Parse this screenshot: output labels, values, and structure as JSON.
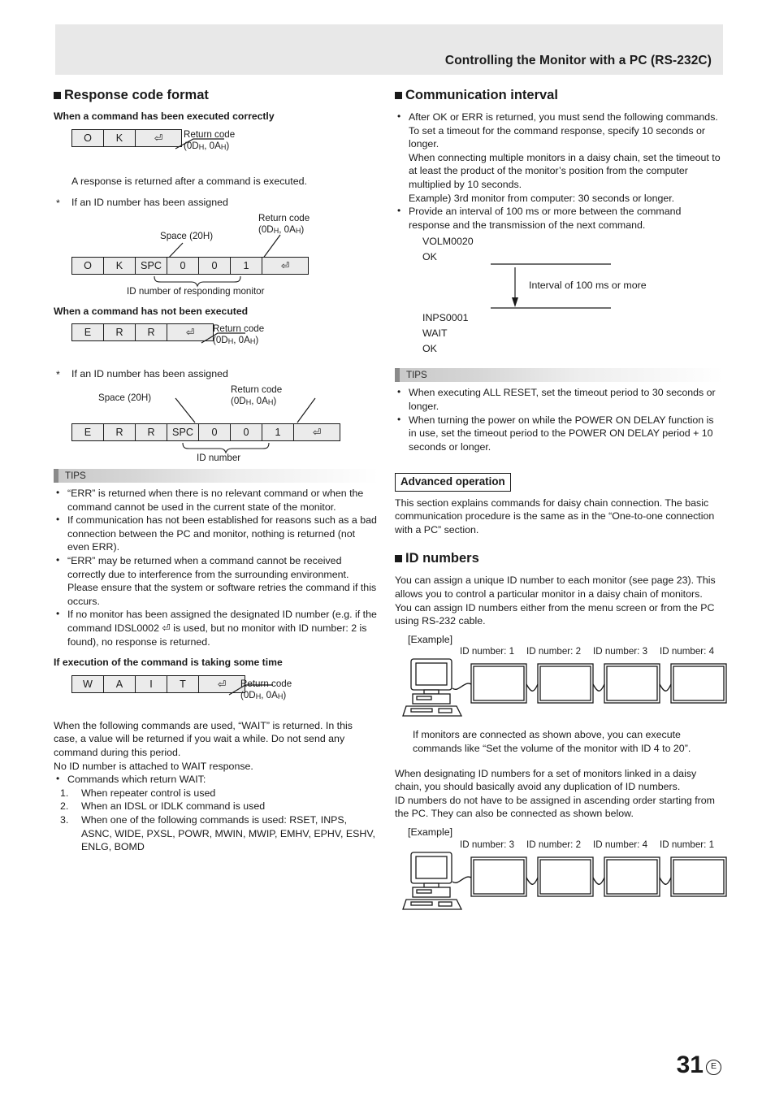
{
  "header": {
    "title": "Controlling the Monitor with a PC (RS-232C)"
  },
  "left": {
    "section_title": "Response code format",
    "sub1": "When a command has been executed correctly",
    "ok_cells": [
      "O",
      "K",
      "⏎"
    ],
    "ok_callout_line1": "Return code",
    "ok_callout_line2": "(0DH, 0AH)",
    "p_response": "A response is returned after a command is executed.",
    "star_id_assigned": "If an ID number has been assigned",
    "space_label": "Space (20H)",
    "ok_id_cells": [
      "O",
      "K",
      "SPC",
      "0",
      "0",
      "1",
      "⏎"
    ],
    "ok_id_brace_label": "ID number of responding monitor",
    "sub2": "When a command has not been executed",
    "err_cells": [
      "E",
      "R",
      "R",
      "⏎"
    ],
    "err_id_cells": [
      "E",
      "R",
      "R",
      "SPC",
      "0",
      "0",
      "1",
      "⏎"
    ],
    "err_id_brace_label": "ID number",
    "tips_label": "TIPS",
    "tips": [
      "“ERR” is returned when there is no relevant command or when the command cannot be used in the current state of the monitor.",
      "If communication has not been established for reasons such as a bad connection between the PC and monitor, nothing is returned (not even ERR).",
      "“ERR” may be returned when a command cannot be received correctly due to interference from the surrounding environment.\nPlease ensure that the system or software retries the command if this occurs.",
      "If no monitor has been assigned the designated ID number (e.g. if the command IDSL0002 ⏎ is used, but no monitor with ID number: 2 is found), no response is returned."
    ],
    "sub3": "If execution of the command is taking some time",
    "wait_cells": [
      "W",
      "A",
      "I",
      "T",
      "⏎"
    ],
    "p_wait_1": "When the following commands are used, “WAIT” is returned. In this case, a value will be returned if you wait a while. Do not send any command during this period.",
    "p_wait_2": "No ID number is attached to WAIT response.",
    "wait_bullet": "Commands which return WAIT:",
    "wait_items": [
      {
        "n": "1.",
        "text": "When repeater control is used"
      },
      {
        "n": "2.",
        "text": "When an IDSL or IDLK command is used"
      },
      {
        "n": "3.",
        "text": "When one of the following commands is used: RSET, INPS, ASNC, WIDE, PXSL, POWR, MWIN, MWIP, EMHV, EPHV, ESHV, ENLG, BOMD"
      }
    ]
  },
  "right": {
    "section_title": "Communication interval",
    "bullets": [
      "After OK or ERR is returned, you must send the following commands.\nTo set a timeout for the command response, specify 10 seconds or longer.\nWhen connecting multiple monitors in a daisy chain, set the timeout to at least the product of the monitor’s position from the computer multiplied by 10 seconds.\nExample) 3rd monitor from computer: 30 seconds or longer.",
      "Provide an interval of 100 ms or more between the command response and the transmission of the next command."
    ],
    "interval_diagram": {
      "above": [
        "VOLM0020",
        "OK"
      ],
      "label": "Interval of 100 ms or more",
      "below": [
        "INPS0001",
        "WAIT",
        "OK"
      ]
    },
    "tips_label": "TIPS",
    "tips": [
      "When executing ALL RESET, set the timeout period to 30 seconds or longer.",
      "When turning the power on while the POWER ON DELAY function is in use, set the timeout period to the POWER ON DELAY period + 10 seconds or longer."
    ],
    "advanced_label": "Advanced operation",
    "advanced_text": "This section explains commands for daisy chain connection. The basic communication procedure is the same as in the “One-to-one connection with a PC” section.",
    "id_section_title": "ID numbers",
    "id_p1": "You can assign a unique ID number to each monitor (see page 23). This allows you to control a particular monitor in a daisy chain of monitors.",
    "id_p2": "You can assign ID numbers either from the menu screen or from the PC using RS-232 cable.",
    "example_label": "[Example]",
    "diagram1_labels": [
      "ID number: 1",
      "ID number: 2",
      "ID number: 3",
      "ID number: 4"
    ],
    "after_diagram1": "If monitors are connected as shown above, you can execute commands like “Set the volume of the monitor with ID 4 to 20”.",
    "id_p3": "When designating ID numbers for a set of monitors linked in a daisy chain, you should basically avoid any duplication of ID numbers.",
    "id_p4": "ID numbers do not have to be assigned in ascending order starting from the PC. They can also be connected as shown below.",
    "example_label2": "[Example]",
    "diagram2_labels": [
      "ID number: 3",
      "ID number: 2",
      "ID number: 4",
      "ID number: 1"
    ]
  },
  "footer": {
    "page_number": "31",
    "edition": "E"
  }
}
